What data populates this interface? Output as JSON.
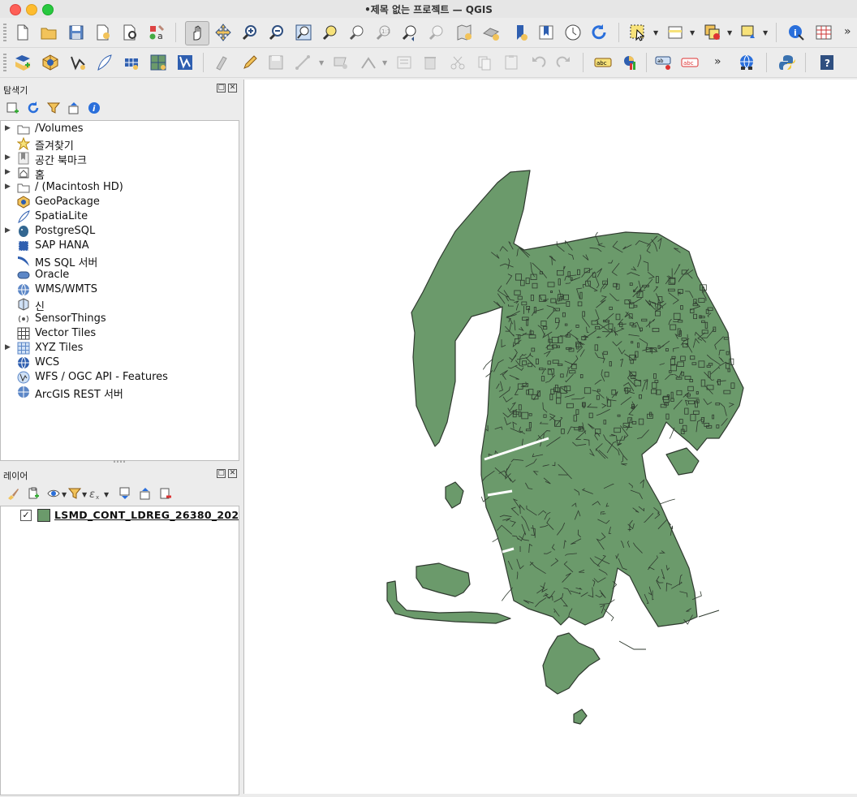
{
  "window": {
    "title": "•제목 없는 프로젝트 — QGIS"
  },
  "toolbar1": {
    "icons": [
      "new-project-icon",
      "open-project-icon",
      "save-project-icon",
      "save-as-icon",
      "project-properties-icon",
      "style-manager-icon",
      "pan-hand-icon",
      "pan-to-selection-icon",
      "zoom-in-icon",
      "zoom-out-icon",
      "zoom-full-icon",
      "zoom-to-selection-icon",
      "zoom-to-layer-icon",
      "zoom-native-icon",
      "zoom-last-icon",
      "zoom-next-icon",
      "new-map-view-icon",
      "new-3d-view-icon",
      "temporal-bookmark-icon",
      "show-bookmarks-icon",
      "temporal-controller-icon",
      "refresh-icon",
      "select-feature-icon",
      "attribute-table-icon",
      "select-by-location-icon",
      "deselect-icon",
      "identify-icon",
      "statistics-icon"
    ],
    "more": "»"
  },
  "toolbar2": {
    "icons": [
      "add-vector-layer-icon",
      "add-geopackage-icon",
      "add-wfs-layer-icon",
      "add-spatialite-icon",
      "add-mesh-icon",
      "add-wms-icon",
      "add-wcs-icon",
      "digitize-icon",
      "edit-pencil-icon",
      "save-edits-icon",
      "add-feature-icon",
      "move-feature-icon",
      "vertex-tool-icon",
      "delete-selected-icon",
      "cut-features-icon",
      "copy-features-icon",
      "paste-features-icon",
      "undo-icon",
      "redo-icon",
      "label-abc-icon",
      "diagram-icon",
      "pin-label-icon",
      "label-highlight-icon",
      "globe-plugin-icon",
      "python-console-icon",
      "help-icon"
    ],
    "more": "»"
  },
  "browser": {
    "title": "탐색기",
    "items": [
      {
        "label": "/Volumes",
        "icon": "folder-icon",
        "expandable": true
      },
      {
        "label": "즐겨찾기",
        "icon": "star-icon",
        "expandable": false
      },
      {
        "label": "공간 북마크",
        "icon": "bookmark-icon",
        "expandable": true
      },
      {
        "label": "홈",
        "icon": "home-icon",
        "expandable": true
      },
      {
        "label": "/ (Macintosh HD)",
        "icon": "folder-icon",
        "expandable": true
      },
      {
        "label": "GeoPackage",
        "icon": "geopackage-icon",
        "expandable": false
      },
      {
        "label": "SpatiaLite",
        "icon": "spatialite-icon",
        "expandable": false
      },
      {
        "label": "PostgreSQL",
        "icon": "postgresql-icon",
        "expandable": true
      },
      {
        "label": "SAP HANA",
        "icon": "sap-hana-icon",
        "expandable": false
      },
      {
        "label": "MS SQL 서버",
        "icon": "mssql-icon",
        "expandable": false
      },
      {
        "label": "Oracle",
        "icon": "oracle-icon",
        "expandable": false
      },
      {
        "label": "WMS/WMTS",
        "icon": "wms-globe-icon",
        "expandable": false
      },
      {
        "label": "신",
        "icon": "scene-cube-icon",
        "expandable": false
      },
      {
        "label": "SensorThings",
        "icon": "sensor-icon",
        "expandable": false
      },
      {
        "label": "Vector Tiles",
        "icon": "vector-tiles-icon",
        "expandable": false
      },
      {
        "label": "XYZ Tiles",
        "icon": "xyz-tiles-icon",
        "expandable": true
      },
      {
        "label": "WCS",
        "icon": "wcs-globe-icon",
        "expandable": false
      },
      {
        "label": "WFS / OGC API - Features",
        "icon": "wfs-icon",
        "expandable": false
      },
      {
        "label": "ArcGIS REST 서버",
        "icon": "arcgis-globe-icon",
        "expandable": false
      }
    ]
  },
  "layers": {
    "title": "레이어",
    "items": [
      {
        "name": "LSMD_CONT_LDREG_26380_202",
        "checked": true,
        "color": "#6b9a6b"
      }
    ]
  },
  "map": {
    "fill": "#6b9a6b",
    "stroke": "#2f3a2f"
  },
  "colors": {
    "accent": "#2a6fdb",
    "polygon": "#6b9a6b"
  }
}
